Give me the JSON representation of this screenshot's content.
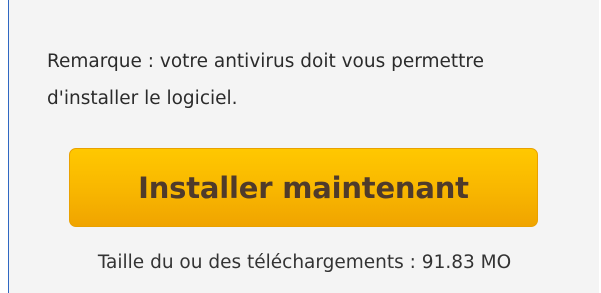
{
  "install_panel": {
    "note": "Remarque : votre antivirus doit vous permettre d'installer le logiciel.",
    "install_button_label": "Installer maintenant",
    "download_size": "Taille du ou des téléchargements : 91.83 MO",
    "colors": {
      "button_top": "#ffc800",
      "button_bottom": "#f0a400",
      "button_text": "#4f3b2b",
      "panel_background": "#f4f4f4",
      "panel_border": "#2f67c2"
    }
  }
}
